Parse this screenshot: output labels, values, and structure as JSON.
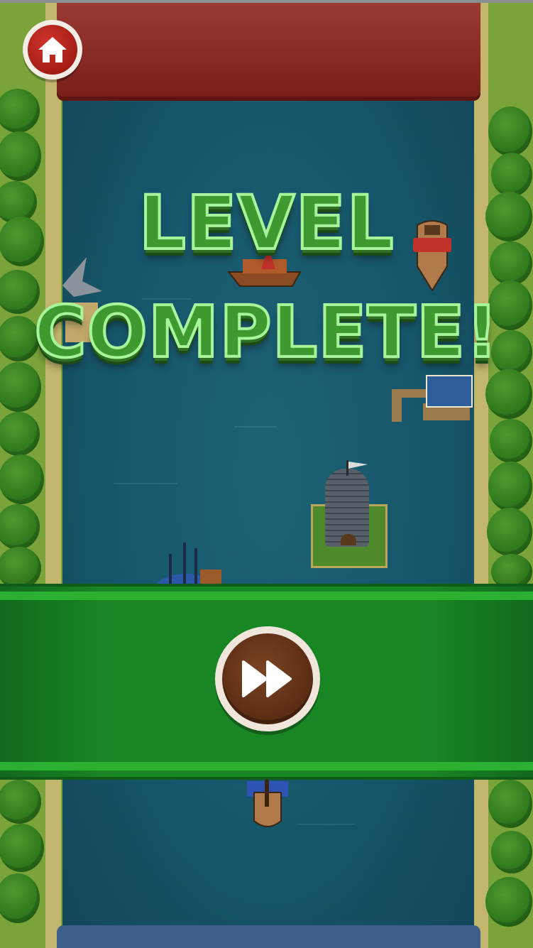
{
  "title": {
    "line1": "LEVEL",
    "line2": "COMPLETE!"
  },
  "controls": {
    "home_icon": "home-icon",
    "next_icon": "fast-forward-icon"
  },
  "colors": {
    "title_fill": "#3e9a2e",
    "title_outline": "#a6f59a",
    "banner": "#198624",
    "home_button": "#c0281f",
    "next_button": "#5a2c12",
    "river": "#16566a"
  }
}
